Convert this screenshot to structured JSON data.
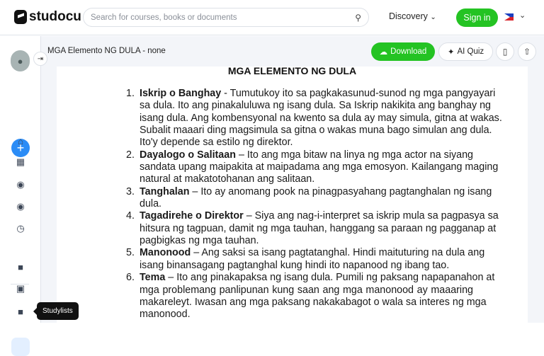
{
  "header": {
    "brand": "studocu",
    "search_placeholder": "Search for courses, books or documents",
    "discovery_label": "Discovery",
    "signin_label": "Sign in"
  },
  "sidebar": {
    "tooltip": "Studylists"
  },
  "toolbar": {
    "doc_title": "MGA Elemento NG DULA - none",
    "download_label": "Download",
    "ai_quiz_label": "AI Quiz"
  },
  "document": {
    "title": "MGA ELEMENTO NG DULA",
    "items": [
      {
        "num": "1.",
        "term": "Iskrip o Banghay",
        "lines": [
          " - Tumutukoy ito sa pagkakasunud-sunod ng mga pangyayari",
          "sa dula. Ito ang pinakaluluwa ng isang dula. Sa Iskrip nakikita ang banghay ng",
          "isang dula. Ang kombensyonal na kwento sa dula ay may simula, gitna at wakas.",
          "Subalit maaari ding magsimula sa gitna o wakas muna bago simulan ang dula.",
          "Ito'y depende sa estilo ng direktor."
        ]
      },
      {
        "num": "2.",
        "term": "Dayalogo o Salitaan",
        "lines": [
          " – Ito ang mga bitaw na linya ng mga actor na siyang",
          "sandata upang maipakita at maipadama ang mga emosyon. Kailangang maging",
          "natural at makatotohanan ang salitaan."
        ]
      },
      {
        "num": "3.",
        "term": "Tanghalan",
        "lines": [
          " – Ito ay anomang pook na pinagpasyahang pagtanghalan ng isang",
          "dula."
        ]
      },
      {
        "num": "4.",
        "term": "Tagadirehe o Direktor",
        "lines": [
          " – Siya ang nag-i-interpret sa iskrip mula sa pagpasya sa",
          "hitsura ng tagpuan, damit ng mga tauhan, hanggang sa paraan ng pagganap at",
          "pagbigkas ng mga tauhan."
        ]
      },
      {
        "num": "5.",
        "term": "Manonood",
        "lines": [
          " – Ang saksi sa isang pagtatanghal. Hindi maituturing na dula ang",
          "isang binansagang pagtanghal kung hindi ito napanood ng ibang tao."
        ]
      },
      {
        "num": "6.",
        "term": "Tema",
        "lines": [
          " – Ito ang pinakapaksa ng isang dula. Pumili ng paksang napapanahon at",
          "mga problemang panlipunan kung saan ang mga manonood ay maaaring",
          "makareleyt. Iwasan ang mga paksang nakakabagot o wala sa interes ng mga",
          "manonood."
        ]
      }
    ]
  }
}
